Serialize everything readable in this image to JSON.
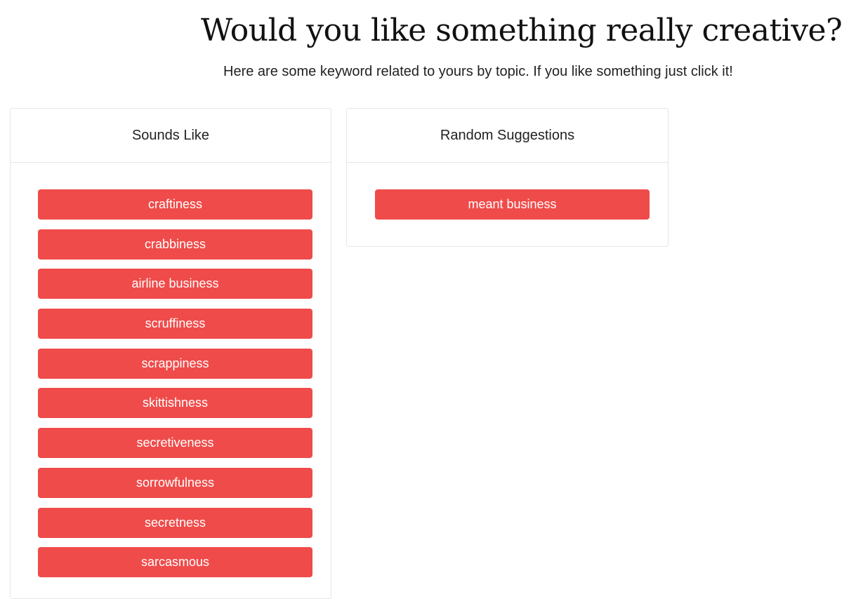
{
  "header": {
    "title": "Would you like something really creative?",
    "subtitle": "Here are some keyword related to yours by topic. If you like something just click it!"
  },
  "colors": {
    "button_bg": "#ef4b4a",
    "button_text": "#ffffff"
  },
  "sections": {
    "sounds_like": {
      "title": "Sounds Like",
      "keywords": [
        "craftiness",
        "crabbiness",
        "airline business",
        "scruffiness",
        "scrappiness",
        "skittishness",
        "secretiveness",
        "sorrowfulness",
        "secretness",
        "sarcasmous"
      ]
    },
    "random_suggestions": {
      "title": "Random Suggestions",
      "keywords": [
        "meant business"
      ]
    }
  }
}
